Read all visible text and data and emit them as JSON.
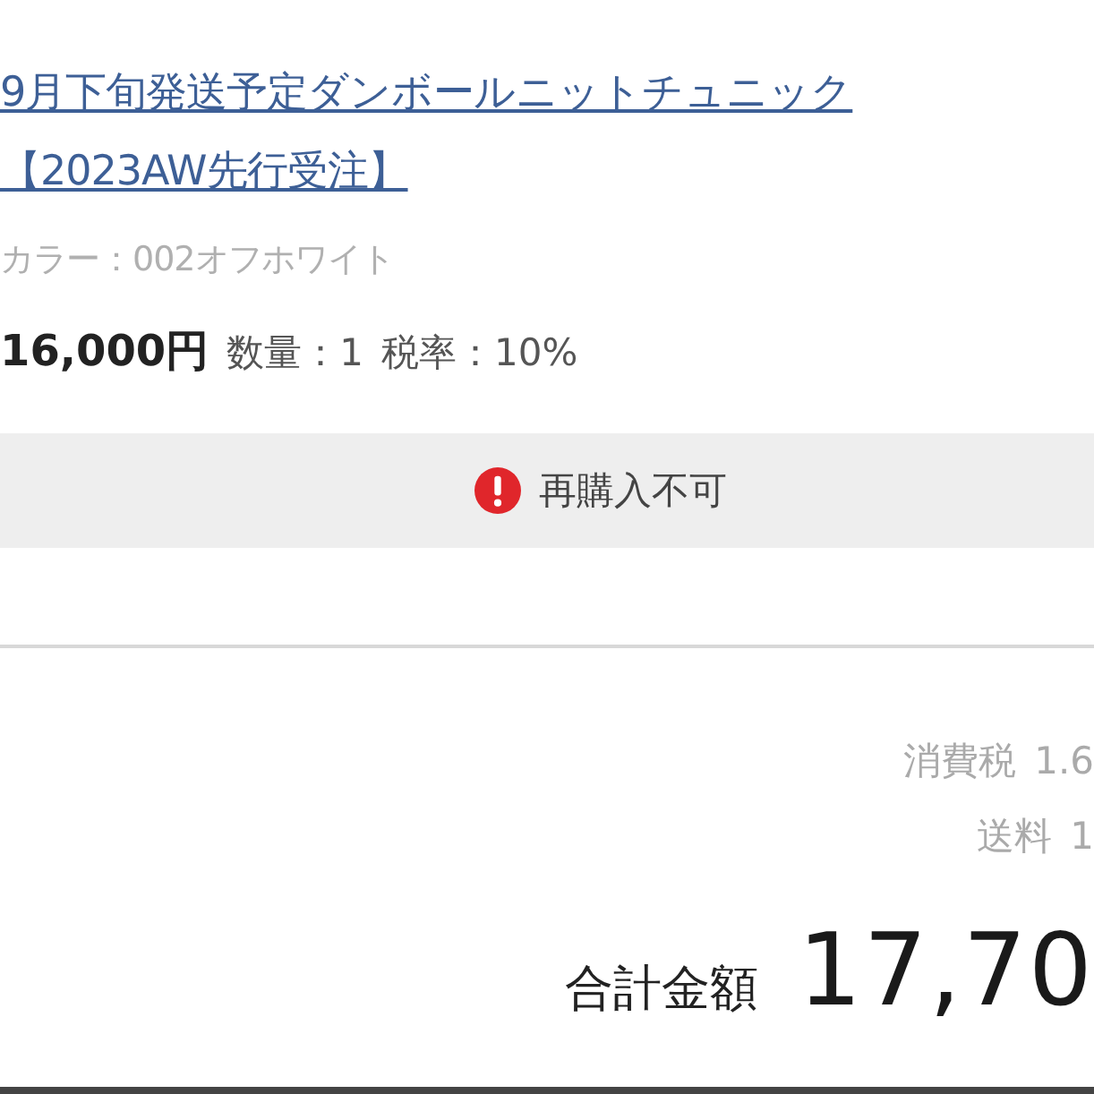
{
  "item": {
    "title_lines": [
      "9月下旬発送予定ダンボールニットチュニック",
      "【2023AW先行受注】"
    ],
    "option": "カラー：002オフホワイト",
    "price": "16,000円",
    "quantity": "数量：1",
    "tax_rate": "税率：10%"
  },
  "notice": {
    "kind": "error",
    "text": "再購入不可"
  },
  "summary": {
    "tax": {
      "label": "消費税",
      "value": "1.6"
    },
    "shipping": {
      "label": "送料",
      "value": "1"
    },
    "total": {
      "label": "合計金額",
      "value": "17,70"
    }
  }
}
